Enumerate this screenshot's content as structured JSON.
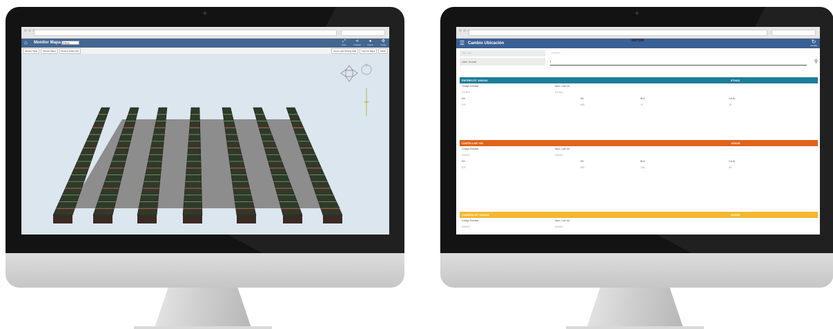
{
  "left_app": {
    "title": "Monitor Mapa",
    "select_value": "PR01",
    "header_icons": [
      {
        "icon": "zoom-icon",
        "label": "Zoom"
      },
      {
        "icon": "share-icon",
        "label": "Compartir"
      },
      {
        "icon": "user-icon",
        "label": "Usuario"
      },
      {
        "icon": "settings-icon",
        "label": "Config."
      }
    ],
    "toolbar_left": [
      "Mostrar Tabla",
      "Mostrar Mapa",
      "Mostrar Todas Ubic"
    ],
    "toolbar_right": [
      "Nuevo para Picking SSE",
      "Imprimir Mapa",
      "Filtrar"
    ],
    "colors": {
      "bar": "#44668f",
      "viewport": "#dce6ef",
      "floor": "#8d8d8d"
    }
  },
  "right_app": {
    "title": "Cambio Ubicación",
    "refresh_label": "Limpiar",
    "form": {
      "field1_label": "Ubic. Ant.",
      "field1_value": "D03000",
      "field2_label": "Ubic. Actual",
      "search_value": "|"
    },
    "cards": [
      {
        "title": "ENTRECOT 100/140",
        "code": "070411",
        "color": "#1e7d9b",
        "labels": [
          "Código Entrada",
          "Núm. Lote Int."
        ],
        "values": [
          "071510",
          "071510"
        ],
        "stats_labels": [
          "KN",
          "KB",
          "BUL",
          "CAJA"
        ],
        "stats_values": [
          "570",
          "850",
          "37",
          "25"
        ]
      },
      {
        "title": "COSTILLAR +20",
        "code": "120120",
        "color": "#e0641c",
        "labels": [
          "Código Entrada",
          "Núm. Lote Int."
        ],
        "values": [
          "041510",
          "040110"
        ],
        "stats_labels": [
          "KN",
          "KB",
          "BUL",
          "CAJA"
        ],
        "stats_values": [
          "570",
          "650",
          "125",
          "55"
        ]
      },
      {
        "title": "CADERA S/T 120/160",
        "code": "030420",
        "color": "#f5b82e",
        "labels": [
          "Código Entrada",
          "Núm. Lote Int."
        ],
        "values": [
          "041510",
          "041510"
        ]
      }
    ]
  }
}
